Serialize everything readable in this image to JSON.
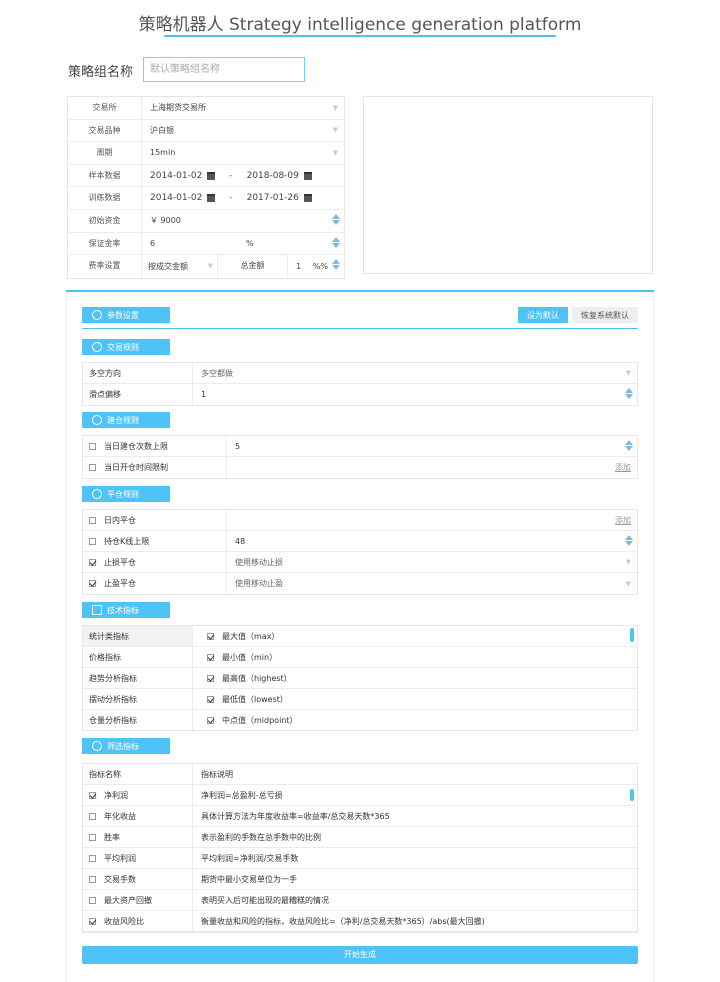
{
  "page": {
    "title": "策略机器人 Strategy intelligence generation platform",
    "group_name_label": "策略组名称",
    "group_name_placeholder": "默认策略组名称"
  },
  "config": {
    "exchange": {
      "label": "交易所",
      "value": "上海期货交易所"
    },
    "variety": {
      "label": "交易品种",
      "value": "沪白银"
    },
    "period": {
      "label": "周期",
      "value": "15min"
    },
    "sample": {
      "label": "样本数据",
      "start": "2014-01-02",
      "sep": "-",
      "end": "2018-08-09"
    },
    "training": {
      "label": "训练数据",
      "start": "2014-01-02",
      "sep": "-",
      "end": "2017-01-26"
    },
    "capital": {
      "label": "初始资金",
      "value": "￥ 9000"
    },
    "margin": {
      "label": "保证金率",
      "value": "6",
      "unit": "%"
    },
    "fee": {
      "label": "费率设置",
      "mode": "按成交金额",
      "amount_label": "总金额",
      "amount": "1",
      "unit": "%%"
    }
  },
  "params": {
    "section_label": "参数设置",
    "btn_set_default": "设为默认",
    "btn_restore_default": "恢复系统默认"
  },
  "trade_rules": {
    "section_label": "交易规则",
    "rows": [
      {
        "label": "多空方向",
        "value": "多空都做"
      },
      {
        "label": "滑点偏移",
        "value": "1"
      }
    ]
  },
  "open_rules": {
    "section_label": "建仓规则",
    "rows": [
      {
        "label": "当日建仓次数上限",
        "value": "5",
        "checked": false
      },
      {
        "label": "当日开仓时间限制",
        "value": "",
        "link": "添加",
        "checked": false
      }
    ]
  },
  "close_rules": {
    "section_label": "平仓规则",
    "rows": [
      {
        "label": "日内平仓",
        "value": "",
        "link": "添加",
        "checked": false
      },
      {
        "label": "持仓K线上限",
        "value": "48",
        "checked": false
      },
      {
        "label": "止损平仓",
        "value": "使用移动止损",
        "checked": true
      },
      {
        "label": "止盈平仓",
        "value": "使用移动止盈",
        "checked": true
      }
    ]
  },
  "tech": {
    "section_label": "技术指标",
    "rows": [
      {
        "category": "统计类指标",
        "item": "最大值（max）"
      },
      {
        "category": "价格指标",
        "item": "最小值（min）"
      },
      {
        "category": "趋势分析指标",
        "item": "最高值（highest）"
      },
      {
        "category": "摆动分析指标",
        "item": "最低值（lowest）"
      },
      {
        "category": "仓量分析指标",
        "item": "中点值（midpoint）"
      }
    ]
  },
  "filter": {
    "section_label": "筛选指标",
    "header": {
      "name": "指标名称",
      "desc": "指标说明"
    },
    "rows": [
      {
        "name": "净利润",
        "desc": "净利润=总盈利-总亏损",
        "checked": true
      },
      {
        "name": "年化收益",
        "desc": "具体计算方法为年度收益率=收益率/总交易天数*365",
        "checked": false
      },
      {
        "name": "胜率",
        "desc": "表示盈利的手数在总手数中的比例",
        "checked": false
      },
      {
        "name": "平均利润",
        "desc": "平均利润=净利润/交易手数",
        "checked": false
      },
      {
        "name": "交易手数",
        "desc": "期货中最小交易单位为一手",
        "checked": false
      },
      {
        "name": "最大资产回撤",
        "desc": "表明买入后可能出现的最糟糕的情况",
        "checked": false
      },
      {
        "name": "收益风险比",
        "desc": "衡量收益和风险的指标，收益风险比=（净利/总交易天数*365）/abs(最大回撤)",
        "checked": true
      }
    ]
  },
  "generate_label": "开始生成",
  "colors": {
    "accent": "#4fc3f7"
  }
}
